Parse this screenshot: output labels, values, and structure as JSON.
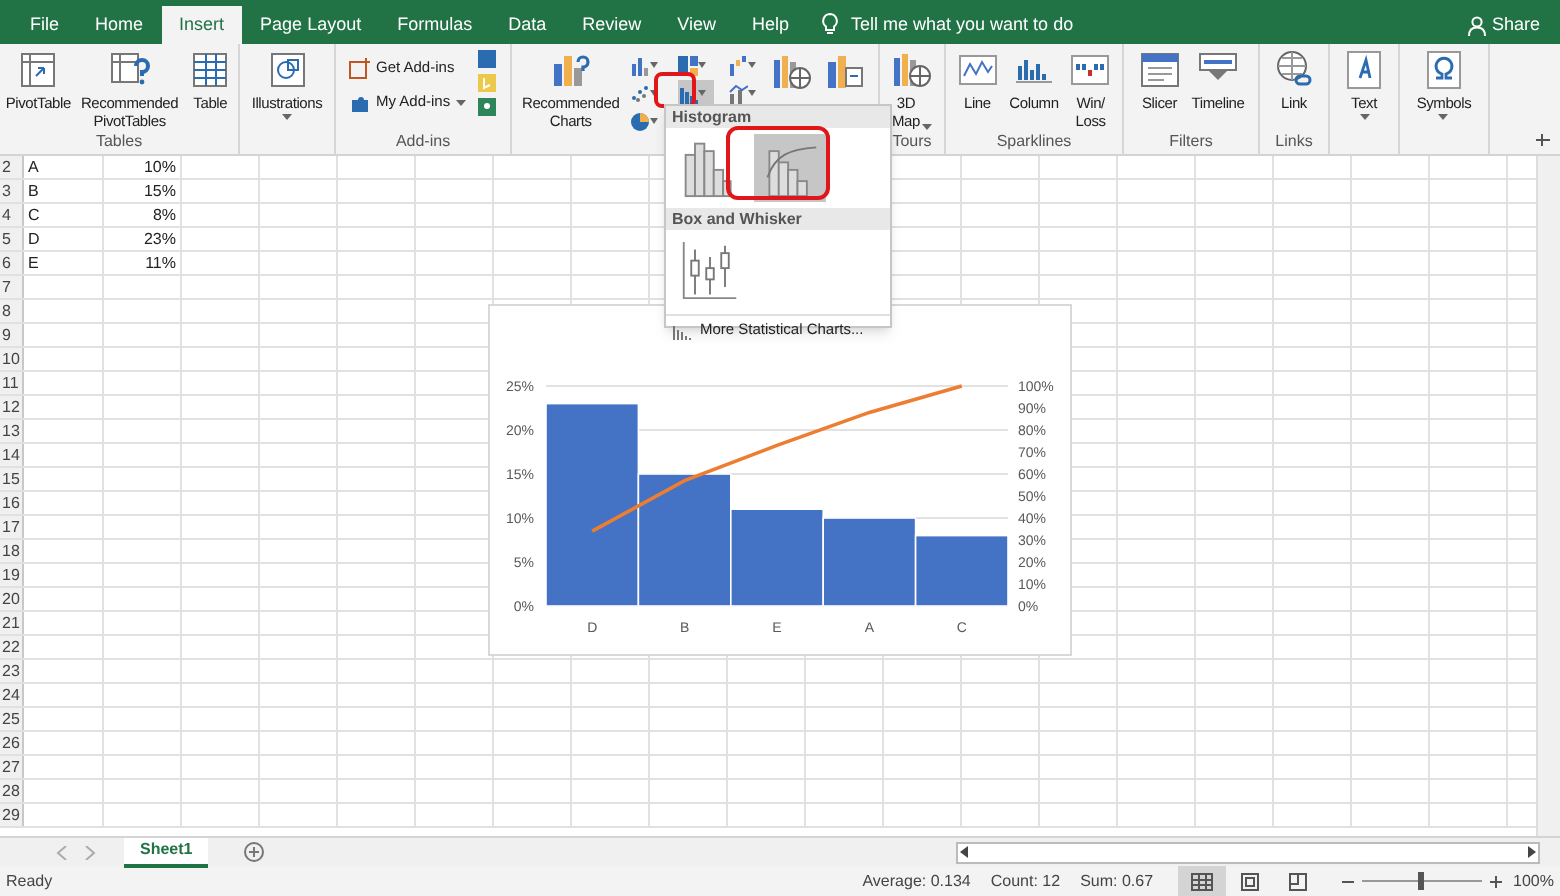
{
  "title_bar": {
    "tabs": [
      {
        "label": "File",
        "selected": false
      },
      {
        "label": "Home",
        "selected": false
      },
      {
        "label": "Insert",
        "selected": true
      },
      {
        "label": "Page Layout",
        "selected": false
      },
      {
        "label": "Formulas",
        "selected": false
      },
      {
        "label": "Data",
        "selected": false
      },
      {
        "label": "Review",
        "selected": false
      },
      {
        "label": "View",
        "selected": false
      },
      {
        "label": "Help",
        "selected": false
      }
    ],
    "tell_me": "Tell me what you want to do",
    "share": "Share"
  },
  "ribbon": {
    "groups": [
      {
        "label": "Tables",
        "buttons": [
          {
            "kind": "large",
            "label": "PivotTable",
            "dropdown": false
          },
          {
            "kind": "large",
            "label": "Recommended\nPivotTables",
            "dropdown": false
          },
          {
            "kind": "large",
            "label": "Table",
            "dropdown": false
          }
        ]
      },
      {
        "buttons": [
          {
            "kind": "large",
            "label": "Illustrations",
            "dropdown": true
          }
        ]
      },
      {
        "label": "Add-ins",
        "buttons": [
          {
            "kind": "small",
            "label": "Get Add-ins",
            "dropdown": false
          },
          {
            "kind": "small",
            "label": "My Add-ins",
            "dropdown": true
          }
        ]
      },
      {
        "buttons": [
          {
            "kind": "large",
            "label": "Recommended\nCharts",
            "dropdown": false
          }
        ]
      },
      {
        "label": "Tours",
        "buttons": [
          {
            "kind": "large",
            "label": "3D\nMap",
            "dropdown": true
          }
        ]
      },
      {
        "label": "Sparklines",
        "buttons": [
          {
            "kind": "large",
            "label": "Line",
            "dropdown": false
          },
          {
            "kind": "large",
            "label": "Column",
            "dropdown": false
          },
          {
            "kind": "large",
            "label": "Win/\nLoss",
            "dropdown": false
          }
        ]
      },
      {
        "label": "Filters",
        "buttons": [
          {
            "kind": "large",
            "label": "Slicer",
            "dropdown": false
          },
          {
            "kind": "large",
            "label": "Timeline",
            "dropdown": false
          }
        ]
      },
      {
        "label": "Links",
        "buttons": [
          {
            "kind": "large",
            "label": "Link",
            "dropdown": false
          }
        ]
      },
      {
        "buttons": [
          {
            "kind": "large",
            "label": "Text",
            "dropdown": true
          }
        ]
      },
      {
        "buttons": [
          {
            "kind": "large",
            "label": "Symbols",
            "dropdown": true
          }
        ]
      }
    ]
  },
  "sheet": {
    "row_numbers": [
      "2",
      "3",
      "4",
      "5",
      "6",
      "7",
      "8",
      "9",
      "10",
      "11",
      "12",
      "13",
      "14",
      "15",
      "16",
      "17",
      "18",
      "19",
      "20",
      "21",
      "22",
      "23",
      "24",
      "25",
      "26",
      "27",
      "28",
      "29"
    ],
    "rows": [
      [
        "A",
        "10%"
      ],
      [
        "B",
        "15%"
      ],
      [
        "C",
        "8%"
      ],
      [
        "D",
        "23%"
      ],
      [
        "E",
        "11%"
      ]
    ]
  },
  "chart": {
    "chart_data": {
      "type": "bar",
      "grid": true,
      "categories": [
        "D",
        "B",
        "E",
        "A",
        "C"
      ],
      "ylim": [
        0,
        25
      ],
      "y2lim": [
        0,
        100
      ],
      "series": [
        {
          "color": "#4472c4",
          "values": [
            23,
            15,
            11,
            10,
            8
          ]
        },
        {
          "type": "line",
          "axis": "y2",
          "color": "#ed7d31",
          "values": [
            34,
            57,
            73,
            88,
            100
          ]
        }
      ],
      "yticks": [
        {
          "value": 0,
          "label": "0%"
        },
        {
          "value": 5,
          "label": "5%"
        },
        {
          "value": 10,
          "label": "10%"
        },
        {
          "value": 15,
          "label": "15%"
        },
        {
          "value": 20,
          "label": "20%"
        },
        {
          "value": 25,
          "label": "25%"
        }
      ],
      "y2ticks": [
        {
          "value": 0,
          "label": "0%"
        },
        {
          "value": 10,
          "label": "10%"
        },
        {
          "value": 20,
          "label": "20%"
        },
        {
          "value": 30,
          "label": "30%"
        },
        {
          "value": 40,
          "label": "40%"
        },
        {
          "value": 50,
          "label": "50%"
        },
        {
          "value": 60,
          "label": "60%"
        },
        {
          "value": 70,
          "label": "70%"
        },
        {
          "value": 80,
          "label": "80%"
        },
        {
          "value": 90,
          "label": "90%"
        },
        {
          "value": 100,
          "label": "100%"
        }
      ]
    }
  },
  "menu": {
    "sections": [
      {
        "header": "Histogram",
        "items": [
          {
            "selected": false
          },
          {
            "selected": true
          }
        ]
      },
      {
        "header": "Box and Whisker",
        "items": [
          {
            "selected": false
          }
        ]
      }
    ],
    "more": "More Statistical Charts..."
  },
  "sheet_tabs": [
    {
      "label": "Sheet1",
      "selected": true
    }
  ],
  "status_bar": {
    "status": "Ready",
    "average": "Average: 0.134",
    "count": "Count: 12",
    "sum": "Sum: 0.67",
    "views": [
      {
        "selected": true
      },
      {
        "selected": false
      },
      {
        "selected": false
      }
    ],
    "zoom_slider": {
      "level": 0.5
    },
    "zoom": "100%"
  }
}
